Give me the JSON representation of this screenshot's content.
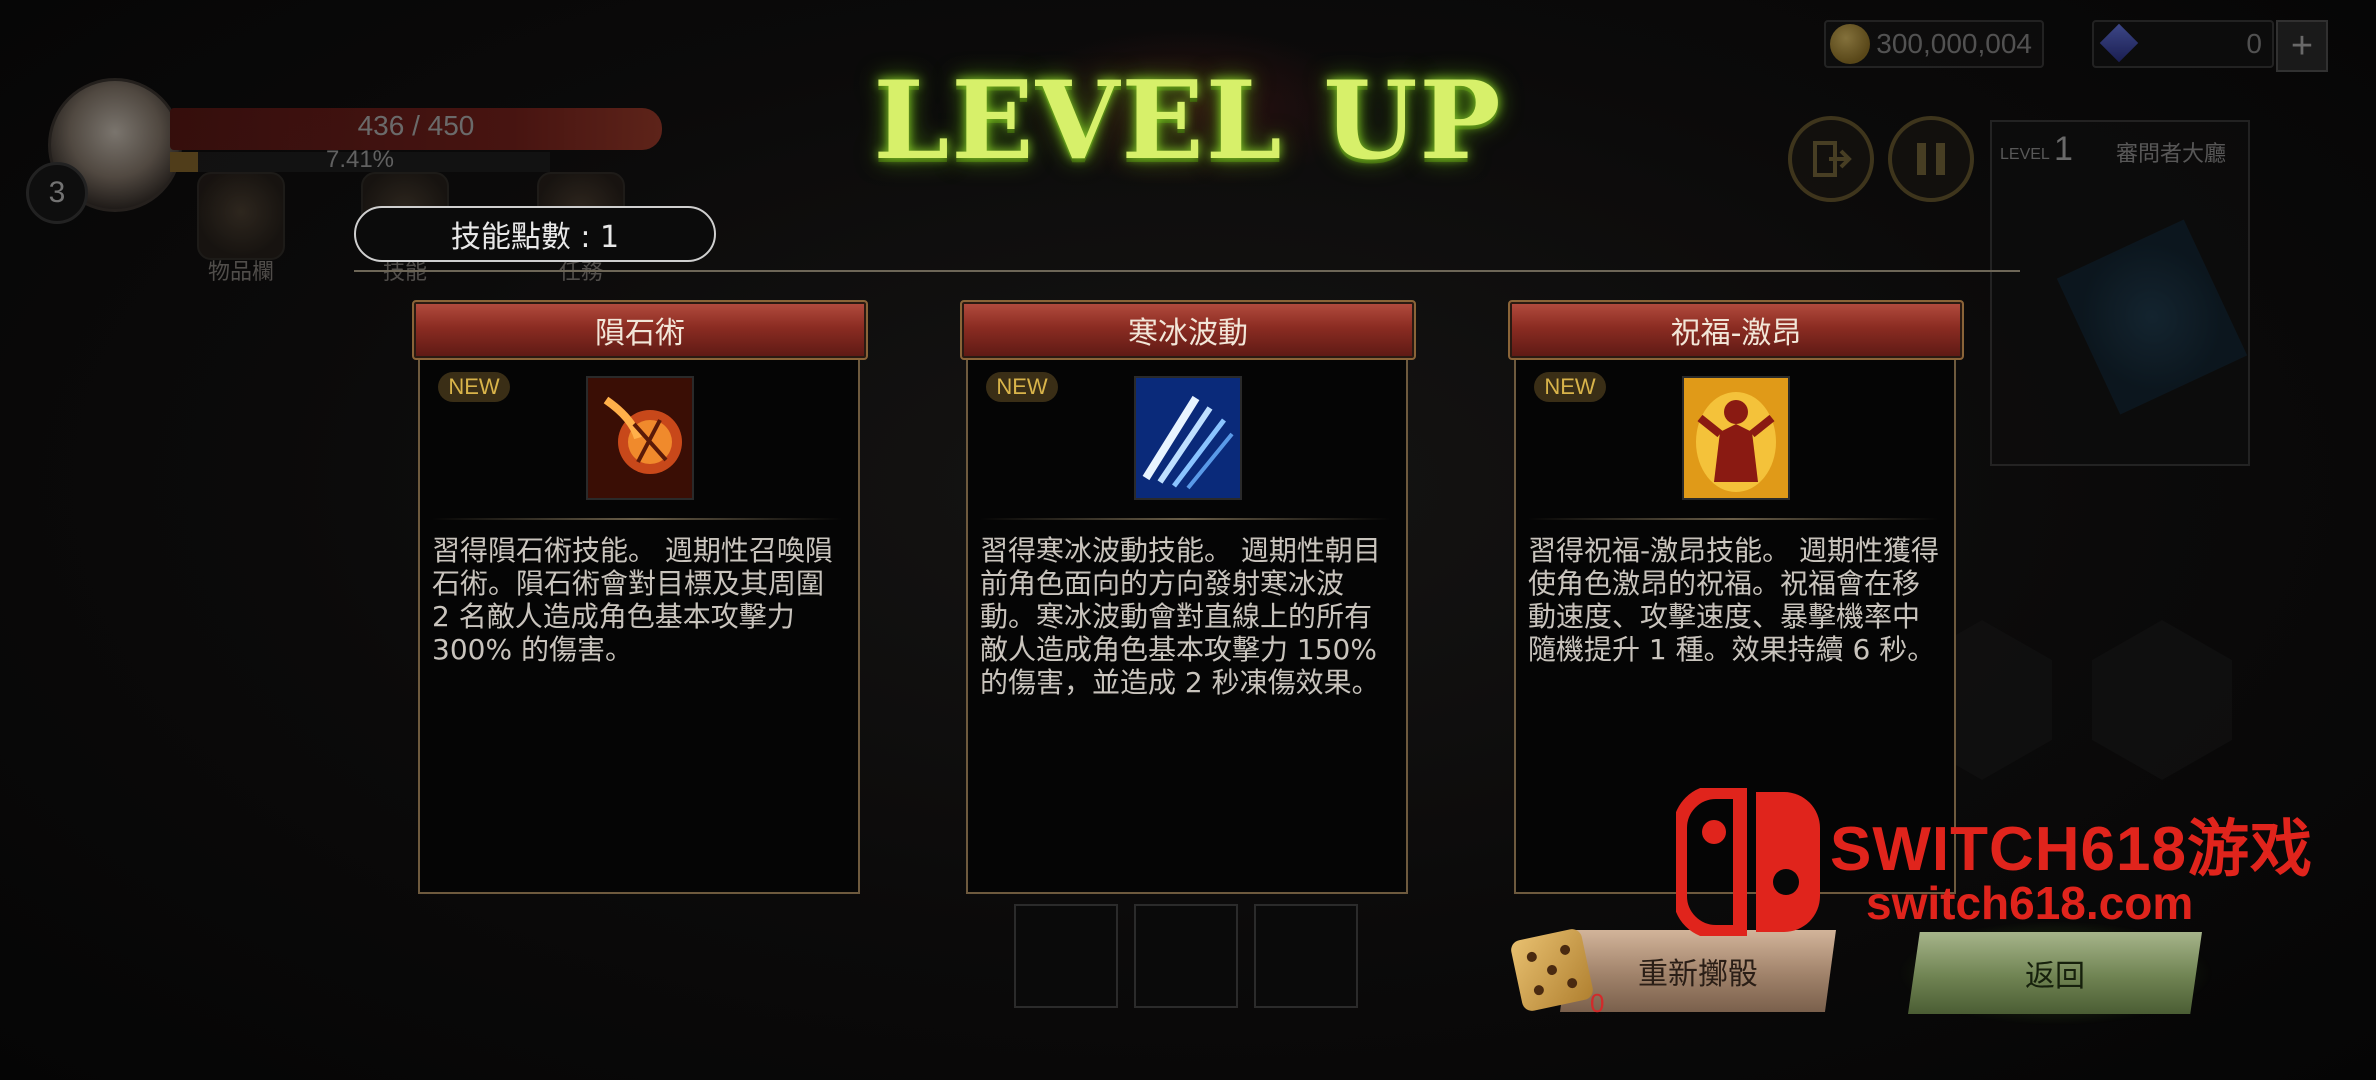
{
  "hud": {
    "player_level": "3",
    "hp_text": "436 / 450",
    "exp_text": "7.41%",
    "exp_fraction": 0.0741,
    "menu": [
      {
        "label": "物品欄"
      },
      {
        "label": "技能"
      },
      {
        "label": "任務"
      }
    ],
    "gold": "300,000,004",
    "gems": "0",
    "add_label": "+",
    "minimap": {
      "level_label": "LEVEL",
      "level": "1",
      "area_name": "審問者大廳"
    }
  },
  "level_up": {
    "title": "LEVEL UP",
    "skill_points": "技能點數 : 1",
    "cards": [
      {
        "name": "隕石術",
        "badge": "NEW",
        "icon": "meteor-icon",
        "description": "習得隕石術技能。 週期性召喚隕石術。隕石術會對目標及其周圍 2 名敵人造成角色基本攻擊力 300% 的傷害。"
      },
      {
        "name": "寒冰波動",
        "badge": "NEW",
        "icon": "ice-wave-icon",
        "description": "習得寒冰波動技能。 週期性朝目前角色面向的方向發射寒冰波動。寒冰波動會對直線上的所有敵人造成角色基本攻擊力 150% 的傷害，並造成 2 秒凍傷效果。"
      },
      {
        "name": "祝福-激昂",
        "badge": "NEW",
        "icon": "blessing-icon",
        "description": "習得祝福-激昂技能。 週期性獲得使角色激昂的祝福。祝福會在移動速度、攻擊速度、暴擊機率中隨機提升 1 種。效果持續 6 秒。"
      }
    ],
    "reroll_label": "重新擲骰",
    "reroll_count": "0",
    "back_label": "返回"
  },
  "watermark": {
    "title": "SWITCH618游戏",
    "url": "switch618.com"
  },
  "colors": {
    "title_green": "#d7f06a",
    "card_header_red": "#8b2c22",
    "watermark_red": "#e0241c"
  }
}
